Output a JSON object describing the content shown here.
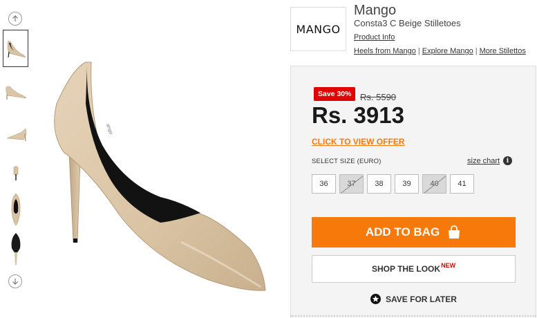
{
  "brand": {
    "logo_text": "MANGO",
    "name": "Mango",
    "product_name": "Consta3 C Beige Stilletoes",
    "product_info_link": "Product Info"
  },
  "related_links": [
    "Heels from Mango",
    "Explore Mango",
    "More Stilettos"
  ],
  "gallery": {
    "up_icon": "arrow-up-circle-icon",
    "down_icon": "arrow-down-circle-icon",
    "thumbnails": [
      "side-view",
      "side-view-small",
      "side-view-far",
      "back-view",
      "top-view",
      "sole-view"
    ],
    "active_index": 0
  },
  "pricing": {
    "save_badge": "Save 30%",
    "mrp": "Rs. 5590",
    "price": "Rs. 3913",
    "offer_link": "CLICK TO VIEW OFFER"
  },
  "sizes": {
    "label": "SELECT SIZE (EURO)",
    "size_chart_link": "size chart",
    "options": [
      {
        "label": "36",
        "available": true
      },
      {
        "label": "37",
        "available": false
      },
      {
        "label": "38",
        "available": true
      },
      {
        "label": "39",
        "available": true
      },
      {
        "label": "40",
        "available": false
      },
      {
        "label": "41",
        "available": true
      }
    ]
  },
  "actions": {
    "add_to_bag": "ADD TO BAG",
    "shop_the_look": "SHOP THE LOOK",
    "new_badge": "NEW",
    "save_for_later": "SAVE FOR LATER"
  },
  "colors": {
    "accent_orange": "#f7790a",
    "sale_red": "#e00000",
    "panel_bg": "#f4f4f4",
    "shoe_beige": "#dcc6a8"
  }
}
